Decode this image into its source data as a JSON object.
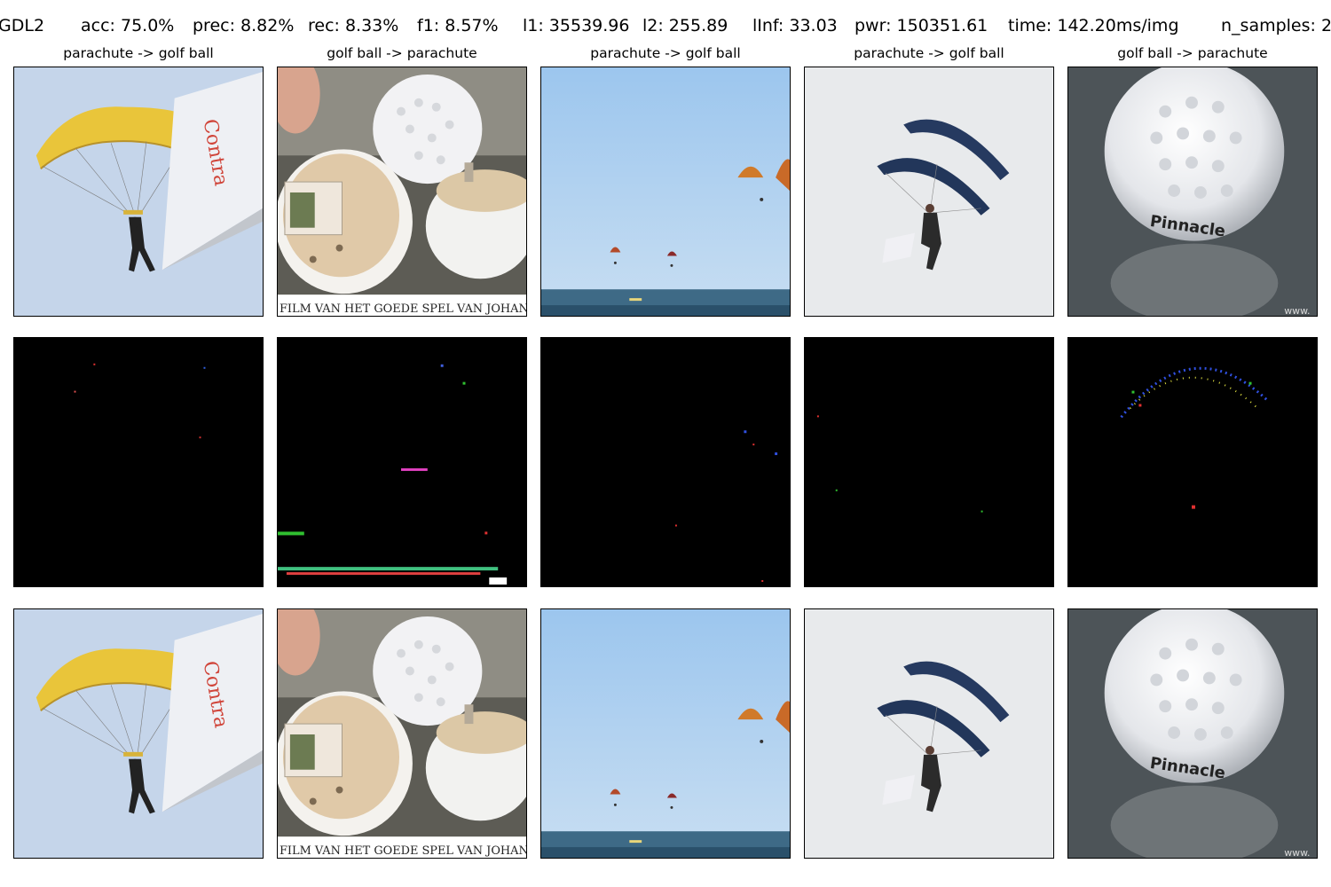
{
  "metrics": {
    "method": "GDL2",
    "acc": "acc: 75.0%",
    "prec": "prec: 8.82%",
    "rec": "rec: 8.33%",
    "f1": "f1: 8.57%",
    "l1": "l1: 35539.96",
    "l2": "l2: 255.89",
    "linf": "lInf: 33.03",
    "pwr": "pwr: 150351.61",
    "time": "time: 142.20ms/img",
    "n_samples": "n_samples: 2"
  },
  "columns": [
    {
      "title": "parachute -> golf ball",
      "scene": "yellow-parachute"
    },
    {
      "title": "golf ball -> parachute",
      "scene": "golf-ball-halves"
    },
    {
      "title": "parachute -> golf ball",
      "scene": "paragliders-over-sea"
    },
    {
      "title": "parachute -> golf ball",
      "scene": "tandem-skydivers"
    },
    {
      "title": "golf ball -> parachute",
      "scene": "pinnacle-golf-ball"
    }
  ],
  "image_text": {
    "dutch_caption": "FILM VAN HET GOEDE SPEL VAN JOHAN:",
    "brand": "Pinnacle",
    "watermark": "www."
  }
}
